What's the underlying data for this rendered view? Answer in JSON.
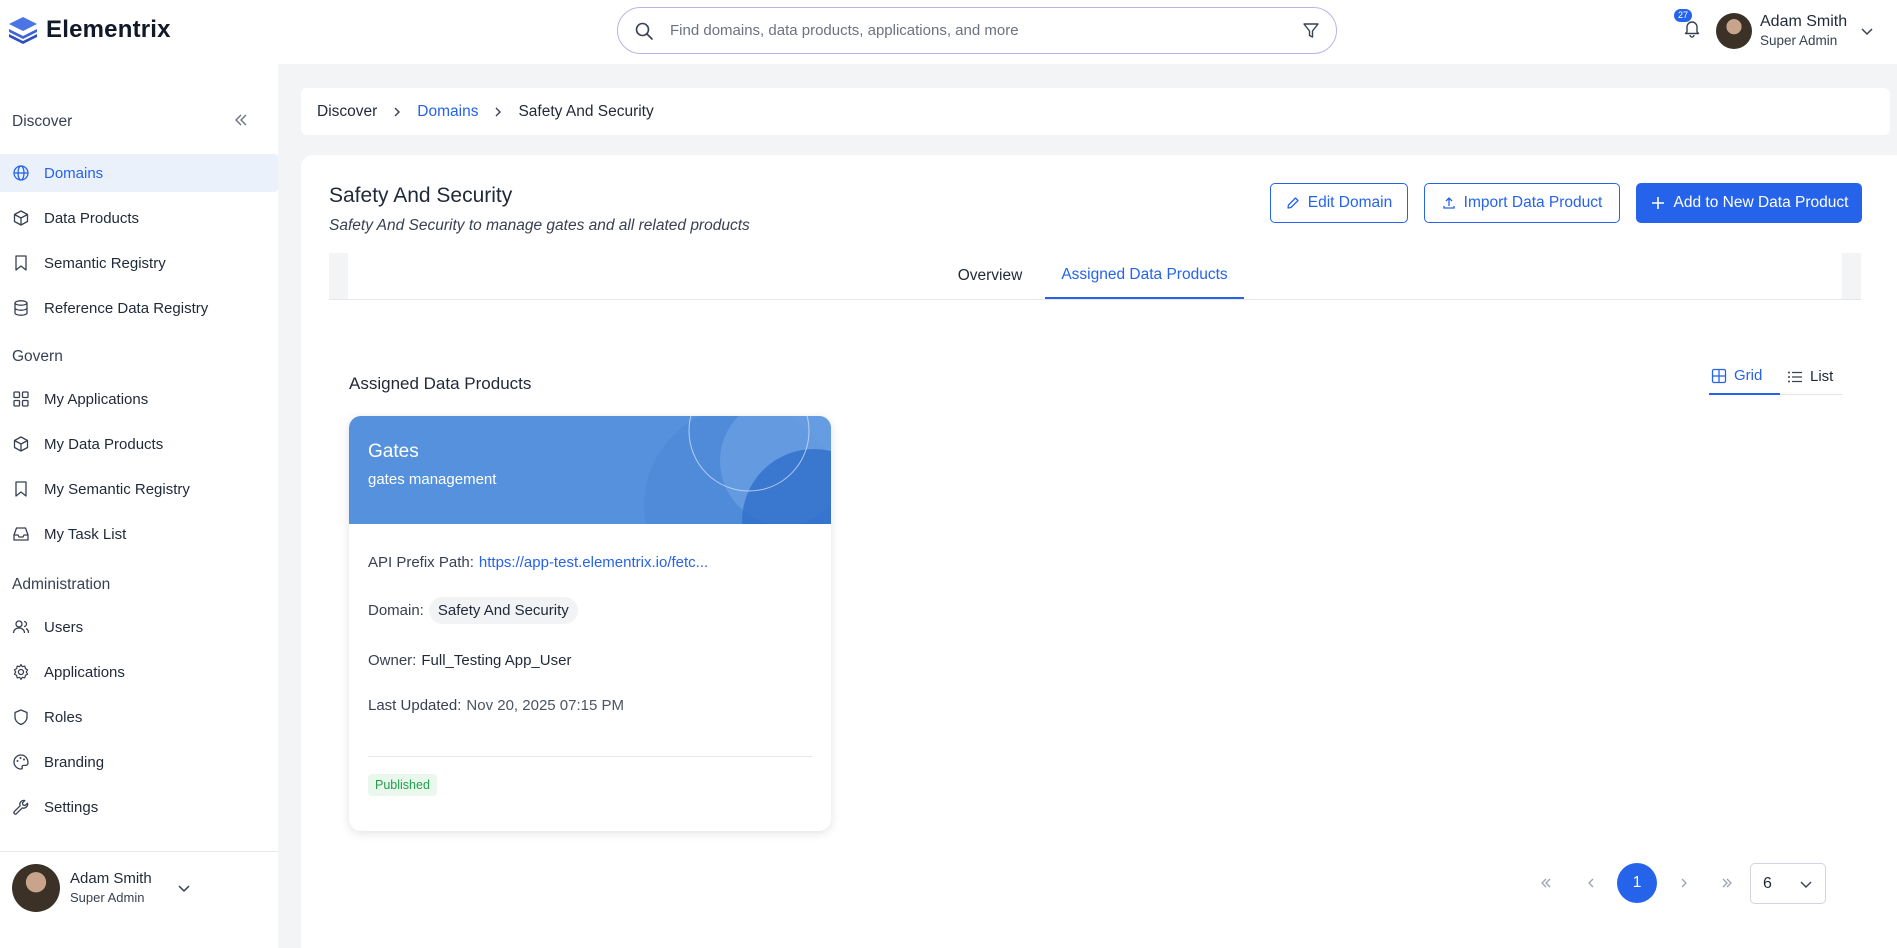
{
  "app": {
    "name": "Elementrix"
  },
  "search": {
    "placeholder": "Find domains, data products, applications, and more"
  },
  "notifications": {
    "count": "27"
  },
  "user": {
    "name": "Adam Smith",
    "role": "Super Admin"
  },
  "sidebar": {
    "sections": [
      {
        "label": "Discover"
      },
      {
        "label": "Govern"
      },
      {
        "label": "Administration"
      }
    ],
    "items": [
      {
        "label": "Domains",
        "icon": "globe-icon",
        "active": true
      },
      {
        "label": "Data Products",
        "icon": "cube-icon"
      },
      {
        "label": "Semantic Registry",
        "icon": "bookmark-icon"
      },
      {
        "label": "Reference Data Registry",
        "icon": "database-icon"
      },
      {
        "label": "My Applications",
        "icon": "grid-icon"
      },
      {
        "label": "My Data Products",
        "icon": "cube-icon"
      },
      {
        "label": "My Semantic Registry",
        "icon": "bookmark-icon"
      },
      {
        "label": "My Task List",
        "icon": "inbox-icon"
      },
      {
        "label": "Users",
        "icon": "users-icon"
      },
      {
        "label": "Applications",
        "icon": "gear-icon"
      },
      {
        "label": "Roles",
        "icon": "shield-icon"
      },
      {
        "label": "Branding",
        "icon": "palette-icon"
      },
      {
        "label": "Settings",
        "icon": "wrench-icon"
      }
    ]
  },
  "breadcrumb": [
    "Discover",
    "Domains",
    "Safety And Security"
  ],
  "domain": {
    "title": "Safety And Security",
    "description": "Safety And Security to manage gates and all related products",
    "actions": {
      "edit": "Edit Domain",
      "import": "Import Data Product",
      "add": "Add to New Data Product"
    },
    "tabs": [
      {
        "label": "Overview"
      },
      {
        "label": "Assigned Data Products",
        "active": true
      }
    ]
  },
  "assigned": {
    "title": "Assigned Data Products",
    "view": {
      "grid": "Grid",
      "list": "List",
      "selected": "Grid"
    },
    "products": [
      {
        "name": "Gates",
        "subtitle": "gates management",
        "api_label": "API Prefix Path:",
        "api_value": "https://app-test.elementrix.io/fetc...",
        "domain_label": "Domain:",
        "domain_value": "Safety And Security",
        "owner_label": "Owner:",
        "owner_value": "Full_Testing App_User",
        "updated_label": "Last Updated:",
        "updated_value": "Nov 20, 2025 07:15 PM",
        "status": "Published"
      }
    ]
  },
  "pagination": {
    "current": "1",
    "page_size": "6"
  },
  "colors": {
    "accent": "#2563eb",
    "card_header": "#5591dd",
    "status_published": "#22a04b"
  }
}
